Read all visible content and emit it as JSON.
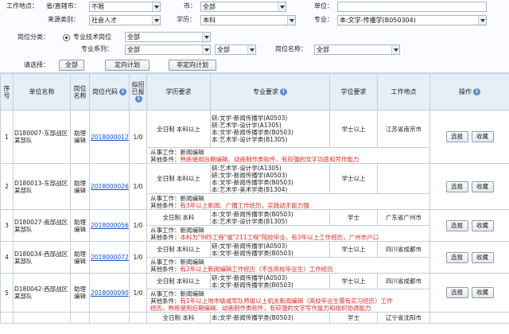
{
  "filters": {
    "work_location_label": "工作地点：",
    "province_label": "省/直辖市：",
    "province_value": "不限",
    "city_label": "市：",
    "city_value": "全部",
    "unit_label": "单位：",
    "unit_value": "",
    "source_label": "来源类别：",
    "source_value": "社会人才",
    "education_label": "学历：",
    "education_value": "本科",
    "major_label": "专业：",
    "major_value": "本:文学-传播学(B050304)",
    "category_label": "岗位分类：",
    "category_radio_label": "专业技术岗位",
    "category_value": "全部",
    "series_label": "专业系列：",
    "series_value_1": "全部",
    "series_value_2": "全部",
    "position_name_label": "岗位名称：",
    "position_name_value": "全部",
    "choose_label": "请选择：",
    "btn_all": "全部",
    "btn_targeted": "定向计划",
    "btn_untargeted": "非定向计划"
  },
  "table": {
    "headers": {
      "no": "序号",
      "unit": "单位名称",
      "position": "岗位名称",
      "code": "岗位代码",
      "plan": "拟招已报",
      "edu": "学历要求",
      "major": "专业要求",
      "degree": "学位要求",
      "location": "工作地点",
      "action": "操作"
    },
    "action_select": "选报",
    "action_fav": "收藏",
    "rows": [
      {
        "no": "1",
        "unit": "D180007-东部战区某部队",
        "position": "助理编辑",
        "code": "2018000012",
        "plan": "1/0",
        "edu": "全日制 本科以上",
        "majors": [
          "研:文学-新闻传播学(A0503)",
          "研:艺术学-设计学(A1305)",
          "本:文学-新闻传播学类(B0503)",
          "本:艺术学-设计学类(B1305)"
        ],
        "degree": "学士以上",
        "location": "江苏省南京市",
        "work": "从事工作：新闻编辑",
        "other_label": "其他条件：",
        "other": "熟练使用后期编辑、动画制作类软件，有较强的文字功底和写作能力"
      },
      {
        "no": "2",
        "unit": "D180013-东部战区某部队",
        "position": "助理编辑",
        "code": "2018000026",
        "plan": "1/0",
        "edu": "全日制 本科以上",
        "majors": [
          "研:艺术学-设计学(A1305)",
          "研:文学-新闻传播学(A0503)",
          "本:文学-新闻传播学类(B0503)",
          "本:艺术学-美术学类(B1304)"
        ],
        "degree": "学士以上",
        "location": "",
        "work": "从事工作：新闻编辑",
        "other_label": "其他条件：",
        "other": "有3年以上新闻、广播工作经历，实践动手能力强"
      },
      {
        "no": "3",
        "unit": "D180027-南部战区某部队",
        "position": "助理编辑",
        "code": "2018000056",
        "plan": "1/0",
        "edu": "全日制 本科",
        "majors": [
          "本:文学-新闻传播学类(B0503)",
          "本:艺术学-设计学类(B1305)"
        ],
        "degree": "学士",
        "location": "广东省广州市",
        "work": "从事工作：新闻编辑",
        "other_label": "其他条件：",
        "other": "本科为\"985工程\"或\"211工程\"院校毕业，有3年以上工作经历，广州市户口"
      },
      {
        "no": "4",
        "unit": "D180034-西部战区某部队",
        "position": "助理编辑",
        "code": "2018000072",
        "plan": "1/0",
        "edu": "全日制 本科以上",
        "majors": [
          "研:文学-新闻传播学(A0503)",
          "本:文学-新闻传播学类(B0503)"
        ],
        "degree": "学士以上",
        "location": "四川省成都市",
        "work": "从事工作：新闻编辑",
        "other_label": "其他条件：",
        "other": "有2年以上新闻编辑工作经历（不含高校毕业生）工作经历"
      },
      {
        "no": "5",
        "unit": "D180042-西部战区某部队",
        "position": "助理编辑",
        "code": "2018000090",
        "plan": "1/0",
        "edu": "全日制 本科以上",
        "majors": [
          "研:文学-新闻传播学(A0503)",
          "本:文学-新闻传播学类(B0503)"
        ],
        "degree": "学士以上",
        "location": "四川省成都市",
        "work": "从事工作：新闻编辑",
        "other_label": "其他条件：",
        "other_lines": [
          "有1年以上地市级或军队师级以上机关新闻编辑（高校毕业生需有实习经历）工作",
          "经历，熟练使用后期编辑、动画制作类软件，有较强的文字写作能力和组织协调能力"
        ]
      },
      {
        "no": "",
        "unit": "",
        "position": "",
        "code": "",
        "plan": "",
        "edu": "全日制 本科",
        "major_partial": "本:文学-新闻传播学类(B0503)",
        "degree": "学士",
        "location": "辽宁省沈阳市"
      }
    ]
  }
}
